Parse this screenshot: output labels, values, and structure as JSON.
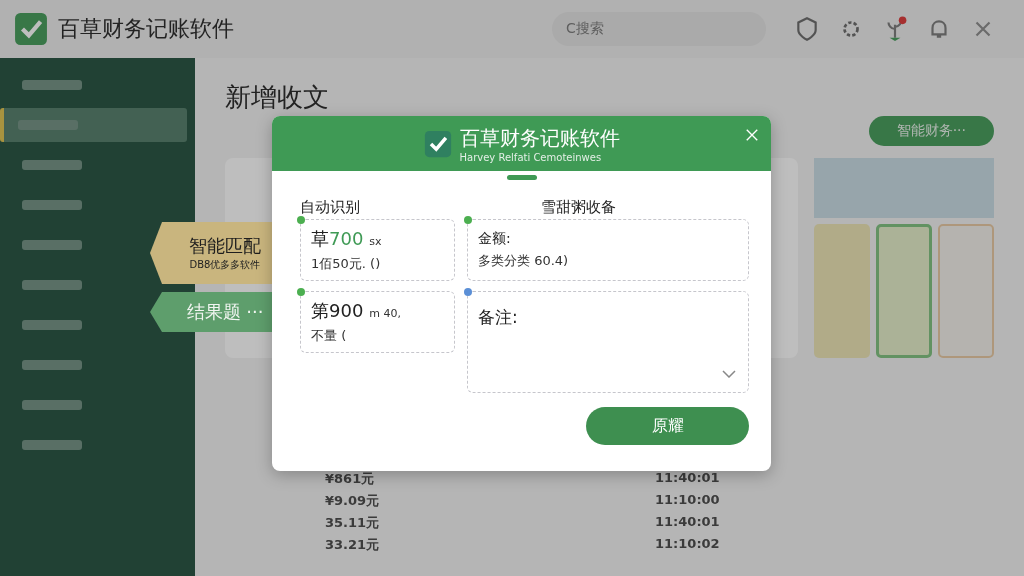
{
  "app": {
    "title": "百草财务记账软件",
    "search_placeholder": "C搜索",
    "notification_badge": true
  },
  "sidebar": {
    "items": [
      {
        "selected": false
      },
      {
        "selected": true
      },
      {
        "selected": false
      },
      {
        "selected": false
      },
      {
        "selected": false
      },
      {
        "selected": false
      },
      {
        "selected": false
      },
      {
        "selected": false
      },
      {
        "selected": false
      },
      {
        "selected": false
      }
    ]
  },
  "page": {
    "title": "新增收文",
    "action_button": "智能财务···"
  },
  "records": [
    {
      "amount": "¥861元",
      "time": "11:40:01"
    },
    {
      "amount": "¥9.09元",
      "time": "11:10:00"
    },
    {
      "amount": "35.11元",
      "time": "11:40:01"
    },
    {
      "amount": "33.21元",
      "time": "11:10:02"
    }
  ],
  "tags": [
    {
      "kind": "match",
      "title": "智能匹配",
      "subtitle": "DB8优多多软件",
      "color": "#c9b57e"
    },
    {
      "kind": "result",
      "title": "结果题 ···",
      "color": "#5e9e6c"
    }
  ],
  "dialog": {
    "title": "百草财务记账软件",
    "subtitle": "Harvey Relfati Cemoteinwes",
    "left_heading": "自动识别",
    "right_heading": "雪甜粥收备",
    "cards": [
      {
        "prefix": "草",
        "amount": "700",
        "unit": "sx",
        "detail": "1佰50元. ()",
        "color": "#4caf50"
      },
      {
        "prefix": "第",
        "amount": "900",
        "unit": "m 40,",
        "detail": "不量 (",
        "color": "#4caf50"
      }
    ],
    "category": {
      "label": "金额:",
      "value": "多类分类 60.4)",
      "color": "#4caf50"
    },
    "note": {
      "label": "备注:",
      "color": "#5b8fd6"
    },
    "confirm_button": "原耀"
  }
}
